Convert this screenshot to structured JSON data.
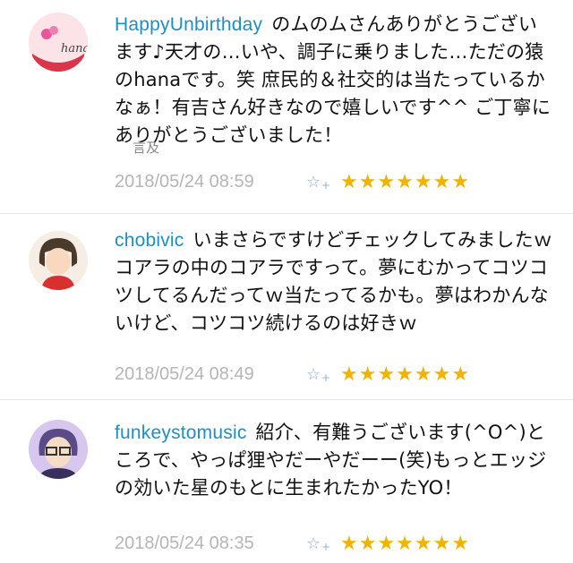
{
  "comments": [
    {
      "user": "HappyUnbirthday",
      "text": "のムのムさんありがとうございます♪天才の…いや、調子に乗りました…ただの猿のhanaです。笑 庶民的＆社交的は当たっているかなぁ！有吉さん好きなので嬉しいです^^ ご丁寧にありがとうございました！",
      "mention_label": "言及",
      "timestamp": "2018/05/24 08:59",
      "fav_icon": "☆",
      "stars": "★★★★★★★",
      "avatar_text": "hana"
    },
    {
      "user": "chobivic",
      "text": "いまさらですけどチェックしてみましたｗコアラの中のコアラですって。夢にむかってコツコツしてるんだってｗ当たってるかも。夢はわかんないけど、コツコツ続けるのは好きｗ",
      "timestamp": "2018/05/24 08:49",
      "fav_icon": "☆",
      "stars": "★★★★★★★"
    },
    {
      "user": "funkeystomusic",
      "text": "紹介、有難うございます(^O^)ところで、やっぱ狸やだーやだーー(笑)もっとエッジの効いた星のもとに生まれたかったYO！",
      "timestamp": "2018/05/24 08:35",
      "fav_icon": "☆",
      "stars": "★★★★★★★"
    }
  ],
  "colors": {
    "username": "#1f8ec0",
    "star": "#f0b400",
    "timestamp": "#b5b5b5",
    "fav_icon": "#8fb0dc"
  }
}
